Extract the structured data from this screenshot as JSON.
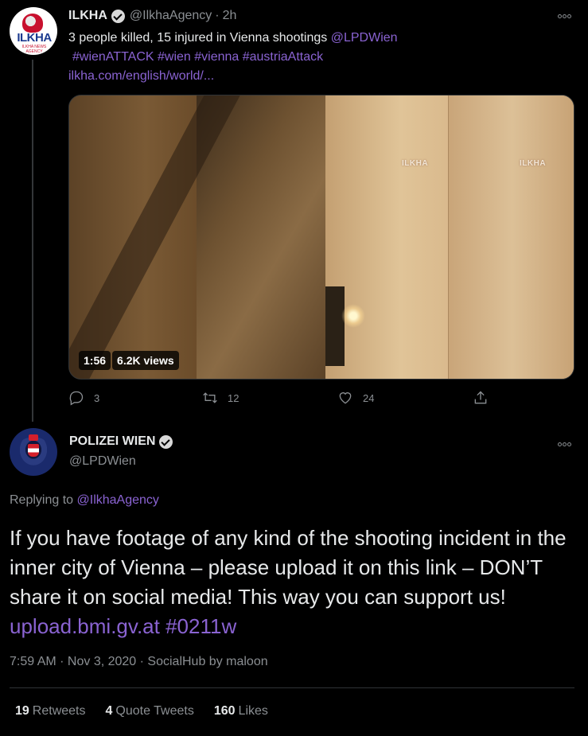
{
  "parent_tweet": {
    "avatar_text": "ILKHA",
    "avatar_subtext": "ILKHA NEWS AGENCY",
    "name": "ILKHA",
    "handle": "@IlkhaAgency",
    "separator": "·",
    "time": "2h",
    "text_plain": "3 people killed, 15 injured in Vienna shootings ",
    "mention": "@LPDWien",
    "hashtags": "#wienATTACK #wien #vienna #austriaAttack",
    "link": "ilkha.com/english/world/...",
    "video": {
      "watermark": "ILKHA",
      "duration": "1:56",
      "views": "6.2K views"
    },
    "actions": {
      "replies": "3",
      "retweets": "12",
      "likes": "24"
    }
  },
  "main_tweet": {
    "name": "POLIZEI WIEN",
    "handle": "@LPDWien",
    "replying_prefix": "Replying to ",
    "replying_to": "@IlkhaAgency",
    "text": "If you have footage of any kind of the shooting incident in the inner city of Vienna – please upload it on this link – DON’T share it on social media! This way you can support us! ",
    "link": "upload.bmi.gv.at",
    "hashtag": "#0211w",
    "meta": "7:59 AM · Nov 3, 2020 · SocialHub by maloon"
  },
  "stats": {
    "retweets_count": "19",
    "retweets_label": "Retweets",
    "quotes_count": "4",
    "quotes_label": "Quote Tweets",
    "likes_count": "160",
    "likes_label": "Likes"
  },
  "colors": {
    "background": "#000000",
    "link": "#8a63d2",
    "muted": "#8b8f93",
    "text": "#e7e9ea"
  },
  "icons": [
    "verified-badge-icon",
    "more-icon",
    "reply-icon",
    "retweet-icon",
    "like-icon",
    "share-icon"
  ]
}
